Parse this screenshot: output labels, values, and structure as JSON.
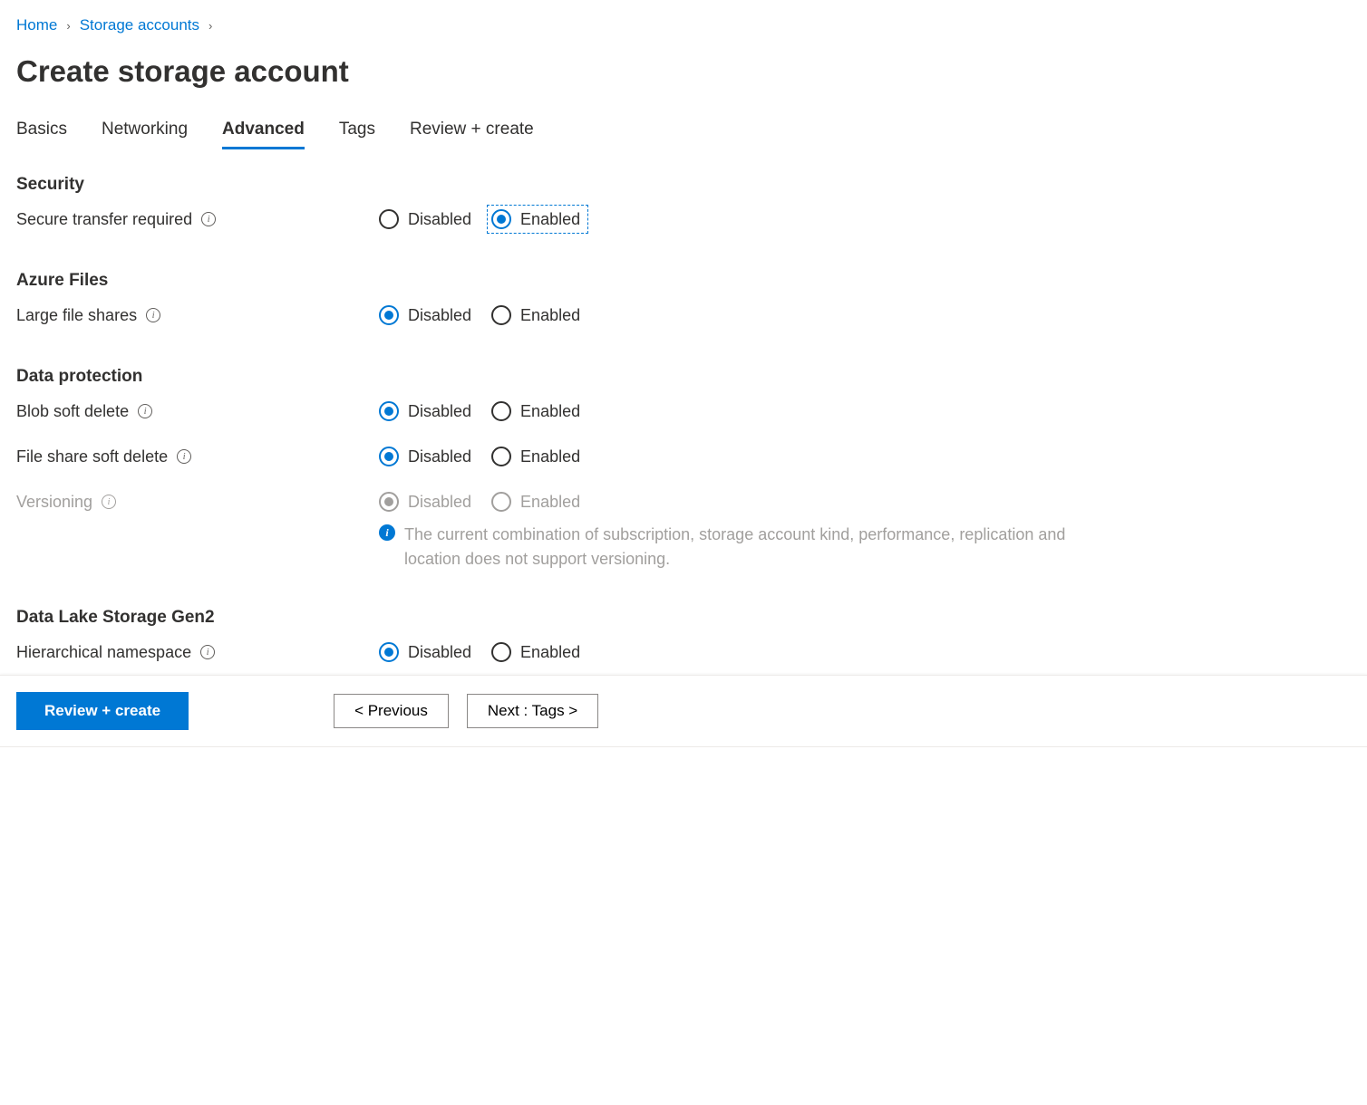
{
  "breadcrumb": {
    "items": [
      "Home",
      "Storage accounts"
    ]
  },
  "page_title": "Create storage account",
  "tabs": [
    "Basics",
    "Networking",
    "Advanced",
    "Tags",
    "Review + create"
  ],
  "active_tab": "Advanced",
  "sections": {
    "security": {
      "heading": "Security",
      "secure_transfer": {
        "label": "Secure transfer required",
        "disabled_label": "Disabled",
        "enabled_label": "Enabled",
        "selected": "enabled",
        "focused": true
      }
    },
    "azure_files": {
      "heading": "Azure Files",
      "large_file_shares": {
        "label": "Large file shares",
        "disabled_label": "Disabled",
        "enabled_label": "Enabled",
        "selected": "disabled"
      }
    },
    "data_protection": {
      "heading": "Data protection",
      "blob_soft_delete": {
        "label": "Blob soft delete",
        "disabled_label": "Disabled",
        "enabled_label": "Enabled",
        "selected": "disabled"
      },
      "file_share_soft_delete": {
        "label": "File share soft delete",
        "disabled_label": "Disabled",
        "enabled_label": "Enabled",
        "selected": "disabled"
      },
      "versioning": {
        "label": "Versioning",
        "disabled_label": "Disabled",
        "enabled_label": "Enabled",
        "selected": "disabled",
        "is_disabled": true,
        "info_message": "The current combination of subscription, storage account kind, performance, replication and location does not support versioning."
      }
    },
    "data_lake": {
      "heading": "Data Lake Storage Gen2",
      "hierarchical_namespace": {
        "label": "Hierarchical namespace",
        "disabled_label": "Disabled",
        "enabled_label": "Enabled",
        "selected": "disabled"
      }
    }
  },
  "footer": {
    "review_create": "Review + create",
    "previous": "< Previous",
    "next": "Next : Tags >"
  }
}
